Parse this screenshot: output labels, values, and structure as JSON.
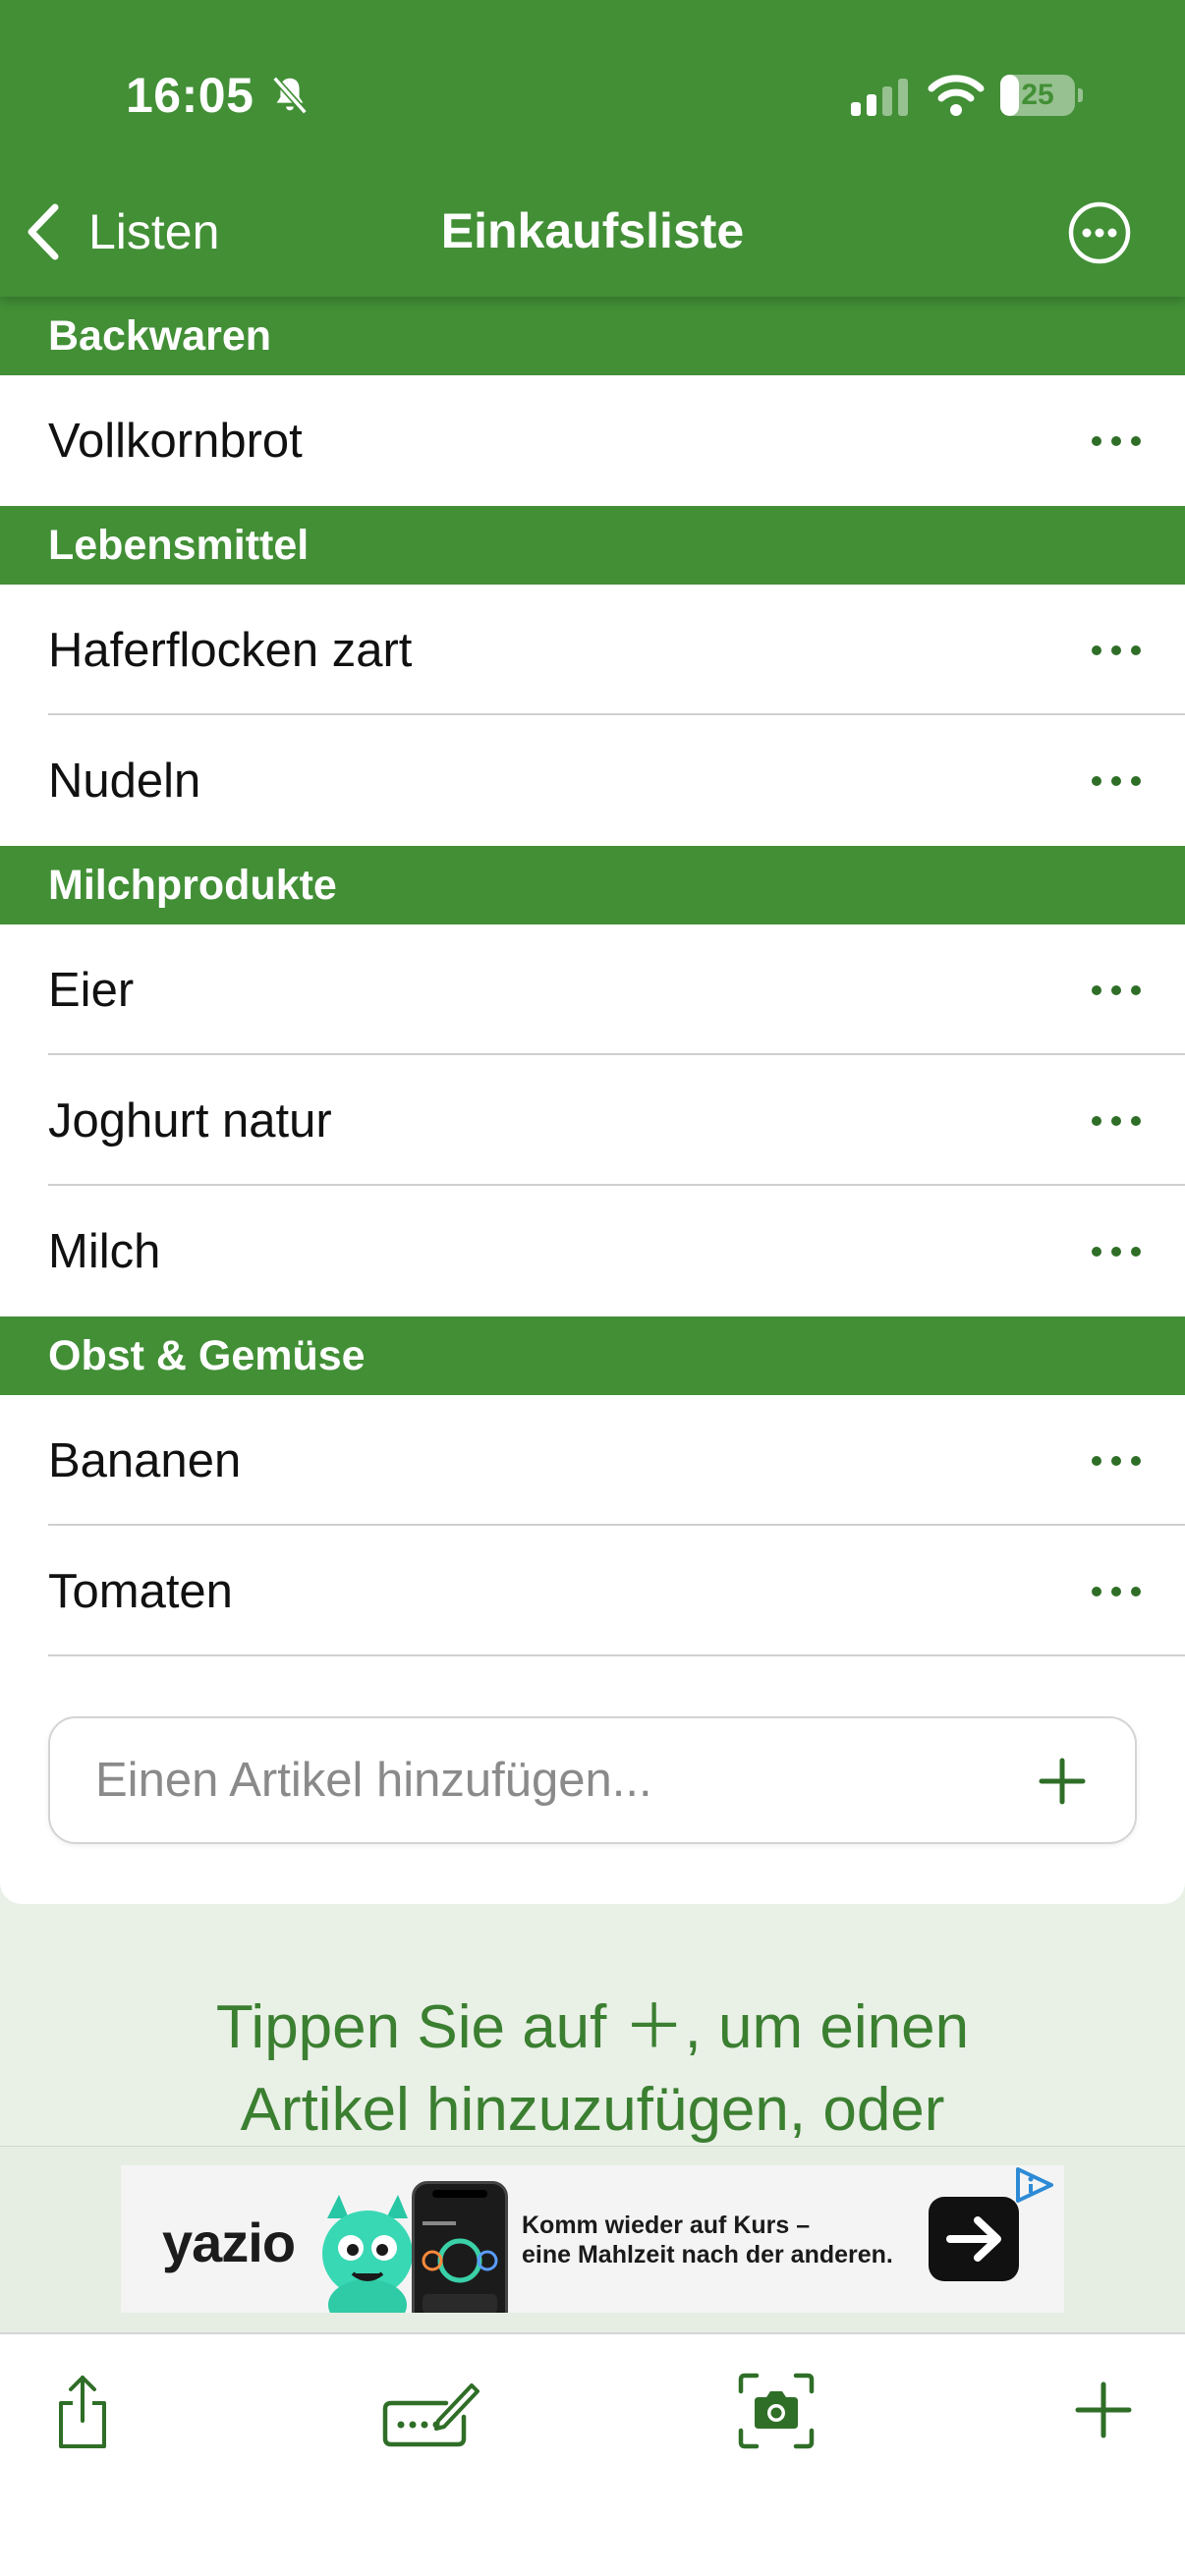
{
  "status_bar": {
    "time": "16:05",
    "battery": "25",
    "battery_level": 0.25,
    "icons": [
      "bell-slash-icon",
      "cellular-signal-icon",
      "wifi-icon",
      "battery-icon"
    ]
  },
  "nav": {
    "back_label": "Listen",
    "title": "Einkaufsliste",
    "more_icon": "ellipsis-circle-icon"
  },
  "sections": [
    {
      "title": "Backwaren",
      "items": [
        "Vollkornbrot"
      ]
    },
    {
      "title": "Lebensmittel",
      "items": [
        "Haferflocken zart",
        "Nudeln"
      ]
    },
    {
      "title": "Milchprodukte",
      "items": [
        "Eier",
        "Joghurt natur",
        "Milch"
      ]
    },
    {
      "title": "Obst & Gemüse",
      "items": [
        "Bananen",
        "Tomaten"
      ]
    }
  ],
  "add_item": {
    "placeholder": "Einen Artikel hinzufügen...",
    "value": ""
  },
  "hint": {
    "line1": "Tippen Sie auf ＋, um einen",
    "line2": "Artikel hinzuzufügen, oder"
  },
  "ad": {
    "brand": "yazio",
    "text_line1": "Komm wieder auf Kurs –",
    "text_line2": "eine Mahlzeit nach der anderen."
  },
  "toolbar": {
    "icons": [
      "share-icon",
      "keyboard-pen-icon",
      "camera-scan-icon",
      "plus-icon"
    ]
  },
  "colors": {
    "primary": "#428f36",
    "hint_text": "#3b7f31",
    "background": "#e9f0e6"
  }
}
